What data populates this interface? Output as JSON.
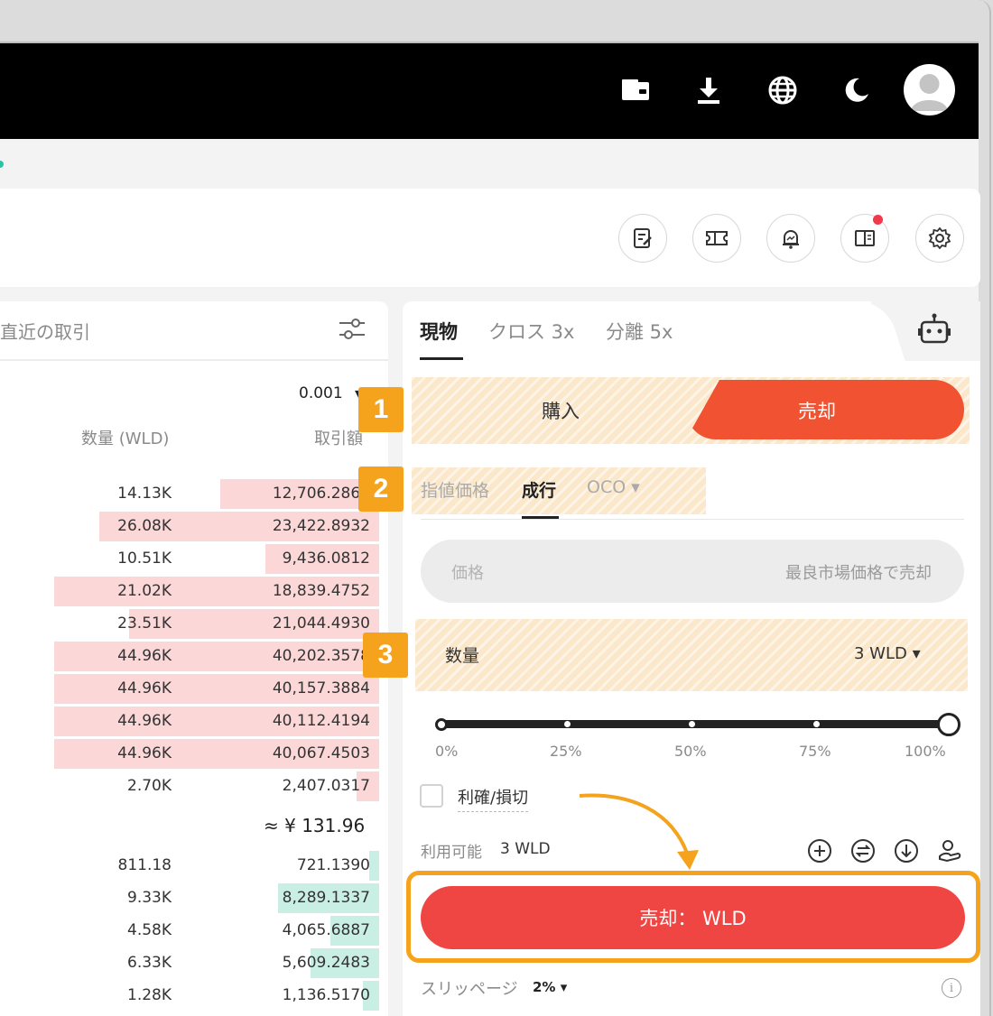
{
  "header": {
    "icons": [
      "wallet-icon",
      "download-icon",
      "globe-icon",
      "moon-icon",
      "avatar"
    ]
  },
  "toolbar": {
    "icons": [
      "note-icon",
      "ticket-icon",
      "bell-icon",
      "book-icon",
      "gear-icon"
    ]
  },
  "trades": {
    "title": "直近の取引",
    "precision": "0.001",
    "col_qty": "数量 (WLD)",
    "col_amt": "取引額",
    "asks": [
      {
        "qty": "14.13K",
        "amt": "12,706.2862",
        "depth": 0.49
      },
      {
        "qty": "26.08K",
        "amt": "23,422.8932",
        "depth": 0.86
      },
      {
        "qty": "10.51K",
        "amt": "9,436.0812",
        "depth": 0.35
      },
      {
        "qty": "21.02K",
        "amt": "18,839.4752",
        "depth": 1.0
      },
      {
        "qty": "23.51K",
        "amt": "21,044.4930",
        "depth": 0.77
      },
      {
        "qty": "44.96K",
        "amt": "40,202.3578",
        "depth": 1.0
      },
      {
        "qty": "44.96K",
        "amt": "40,157.3884",
        "depth": 1.0
      },
      {
        "qty": "44.96K",
        "amt": "40,112.4194",
        "depth": 1.0
      },
      {
        "qty": "44.96K",
        "amt": "40,067.4503",
        "depth": 1.0
      },
      {
        "qty": "2.70K",
        "amt": "2,407.0317",
        "depth": 0.07
      }
    ],
    "mid_price": "≈ ¥ 131.96",
    "bids": [
      {
        "qty": "811.18",
        "amt": "721.1390",
        "depth": 0.03
      },
      {
        "qty": "9.33K",
        "amt": "8,289.1337",
        "depth": 0.31
      },
      {
        "qty": "4.58K",
        "amt": "4,065.6887",
        "depth": 0.15
      },
      {
        "qty": "6.33K",
        "amt": "5,609.2483",
        "depth": 0.21
      },
      {
        "qty": "1.28K",
        "amt": "1,136.5170",
        "depth": 0.05
      }
    ]
  },
  "order": {
    "tabs": [
      {
        "label": "現物",
        "active": true
      },
      {
        "label": "クロス 3x",
        "active": false
      },
      {
        "label": "分離 5x",
        "active": false
      }
    ],
    "buy_label": "購入",
    "sell_label": "売却",
    "order_types": {
      "limit": "指値価格",
      "market": "成行",
      "oco": "OCO ▾"
    },
    "price_label": "価格",
    "price_hint": "最良市場価格で売却",
    "qty_label": "数量",
    "qty_value": "3 WLD ▾",
    "slider_value": 1.0,
    "percent_marks": [
      "0%",
      "25%",
      "50%",
      "75%",
      "100%"
    ],
    "tpsl_label": "利確/損切",
    "available_label": "利用可能",
    "available_value": "3 WLD",
    "submit_label": "売却： WLD",
    "slippage_label": "スリッページ",
    "slippage_value": "2% ▾"
  },
  "annotations": {
    "badges": [
      "1",
      "2",
      "3"
    ],
    "accent_color": "#f5a21c"
  }
}
